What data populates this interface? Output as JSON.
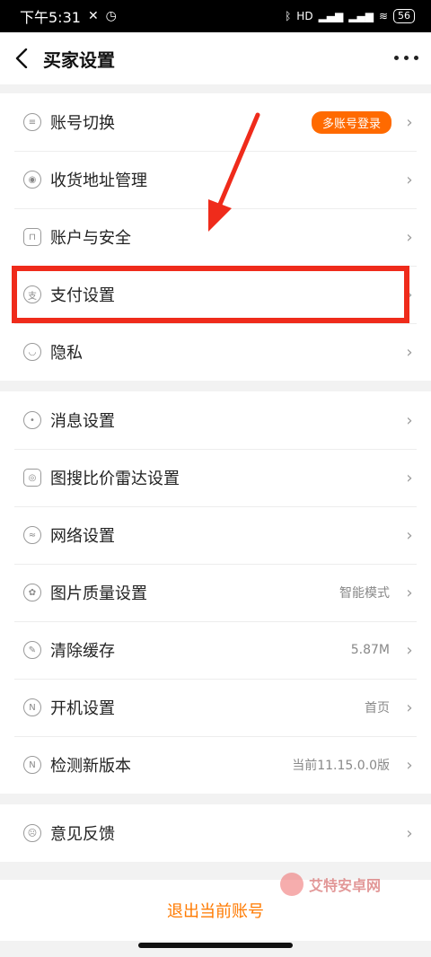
{
  "status_bar": {
    "time": "下午5:31",
    "network": "HD",
    "battery": "56"
  },
  "nav": {
    "title": "买家设置",
    "back_icon": "back-arrow-icon",
    "more_icon": "more-icon"
  },
  "group1": [
    {
      "label": "账号切换",
      "badge": "多账号登录",
      "icon": "account-switch-icon"
    },
    {
      "label": "收货地址管理",
      "icon": "location-icon"
    },
    {
      "label": "账户与安全",
      "icon": "lock-icon"
    },
    {
      "label": "支付设置",
      "icon": "pay-icon"
    },
    {
      "label": "隐私",
      "icon": "eye-icon"
    }
  ],
  "group2": [
    {
      "label": "消息设置",
      "icon": "message-icon"
    },
    {
      "label": "图搜比价雷达设置",
      "icon": "radar-icon"
    },
    {
      "label": "网络设置",
      "icon": "wifi-icon"
    },
    {
      "label": "图片质量设置",
      "value": "智能模式",
      "icon": "image-quality-icon"
    },
    {
      "label": "清除缓存",
      "value": "5.87M",
      "icon": "clear-cache-icon"
    },
    {
      "label": "开机设置",
      "value": "首页",
      "icon": "startup-icon"
    },
    {
      "label": "检测新版本",
      "value": "当前11.15.0.0版",
      "icon": "version-icon"
    }
  ],
  "group3": [
    {
      "label": "意见反馈",
      "icon": "feedback-icon"
    }
  ],
  "logout": {
    "label": "退出当前账号"
  },
  "watermark": {
    "text": "艾特安卓网"
  },
  "colors": {
    "accent": "#ff6a00",
    "highlight": "#ef2b1b"
  }
}
